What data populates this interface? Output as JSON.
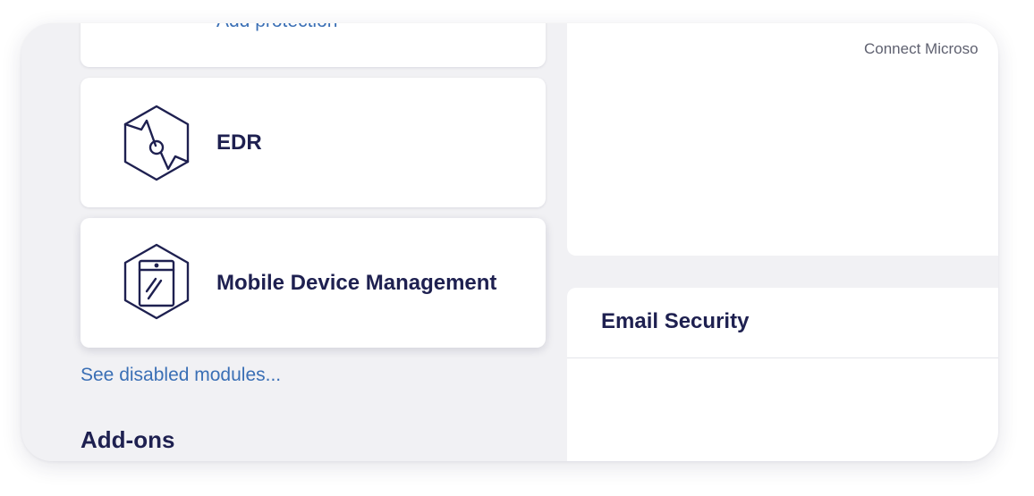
{
  "modules": {
    "top_card": {
      "sublabel": "Add protection",
      "icon": "shield-icon"
    },
    "edr": {
      "label": "EDR",
      "icon": "edr-hexagon-icon"
    },
    "mdm": {
      "label": "Mobile Device Management",
      "icon": "mobile-device-hexagon-icon"
    },
    "see_disabled_link": "See disabled modules..."
  },
  "addons": {
    "title": "Add-ons"
  },
  "right_panel": {
    "connect_text": "Connect Microso",
    "email_security_title": "Email Security"
  },
  "colors": {
    "heading": "#1e2050",
    "link": "#3a6fb5",
    "background": "#f1f1f4",
    "card": "#ffffff"
  }
}
